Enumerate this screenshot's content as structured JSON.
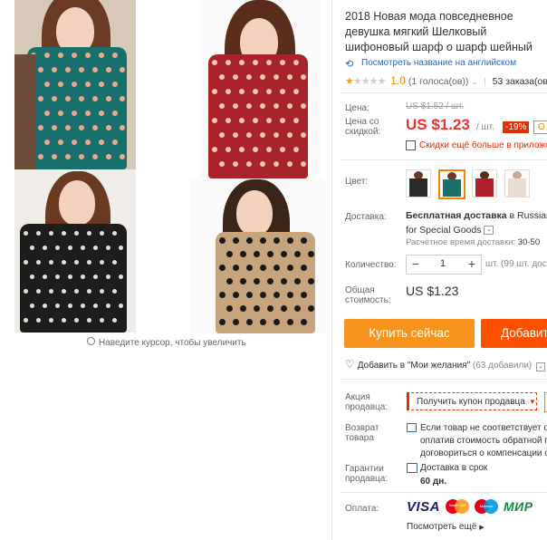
{
  "gallery": {
    "zoom_hint": "Наведите курсор, чтобы увеличить"
  },
  "product": {
    "title": "2018 Новая мода повседневное девушка мягкий Шелковый шифоновый шарф о шарф шейный",
    "translate_link": "Посмотреть название на английском",
    "rating_value": "1.0",
    "rating_votes": "(1 голоса(ов))",
    "rating_stars": 1,
    "orders": "53 заказа(ов)"
  },
  "price": {
    "price_label": "Цена:",
    "old_price": "US $1.52 / шт.",
    "discount_label": "Цена со скидкой:",
    "new_price": "US $1.23",
    "unit": "/ шт.",
    "discount_badge": "-19%",
    "discount_extra": "О",
    "app_promo": "Скидки ещё больше в приложе"
  },
  "color": {
    "label": "Цвет:",
    "swatches": [
      {
        "name": "black",
        "color": "#2a2a2a"
      },
      {
        "name": "teal",
        "color": "#1e6e6a"
      },
      {
        "name": "red",
        "color": "#b0202a"
      },
      {
        "name": "beige",
        "color": "#e8ddd0"
      }
    ],
    "selected_index": 1
  },
  "shipping": {
    "label": "Доставка:",
    "title_bold": "Бесплатная доставка",
    "title_rest": " в Russian F",
    "subtitle": "for Special Goods",
    "time_label": "Расчётное время доставки:",
    "time_value": " 30-50"
  },
  "quantity": {
    "label": "Количество:",
    "minus": "−",
    "value": "1",
    "plus": "+",
    "available": "шт. (99 шт. досту"
  },
  "total": {
    "label": "Общая стоимость:",
    "value": "US $1.23"
  },
  "actions": {
    "buy_now": "Купить сейчас",
    "add_to_cart": "Добавит",
    "wishlist": "Добавить в \"Мои желания\"",
    "wishlist_count": " (63 добавили)"
  },
  "seller_promo": {
    "label": "Акция продавца:",
    "coupon": "Получить купон продавца"
  },
  "returns": {
    "label": "Возврат товара",
    "line1": "Если товар не соответствует оп",
    "line2": "оплатив стоимость обратной п",
    "line3": "договориться о компенсации с"
  },
  "guarantee": {
    "label": "Гарантии продавца:",
    "line1": "Доставка в срок",
    "line2": "60 дн."
  },
  "payment": {
    "label": "Оплата:",
    "visa": "VISA",
    "mastercard": "MasterCard",
    "maestro": "Maestro",
    "mir": "МИР",
    "more": "Посмотреть ещё"
  }
}
